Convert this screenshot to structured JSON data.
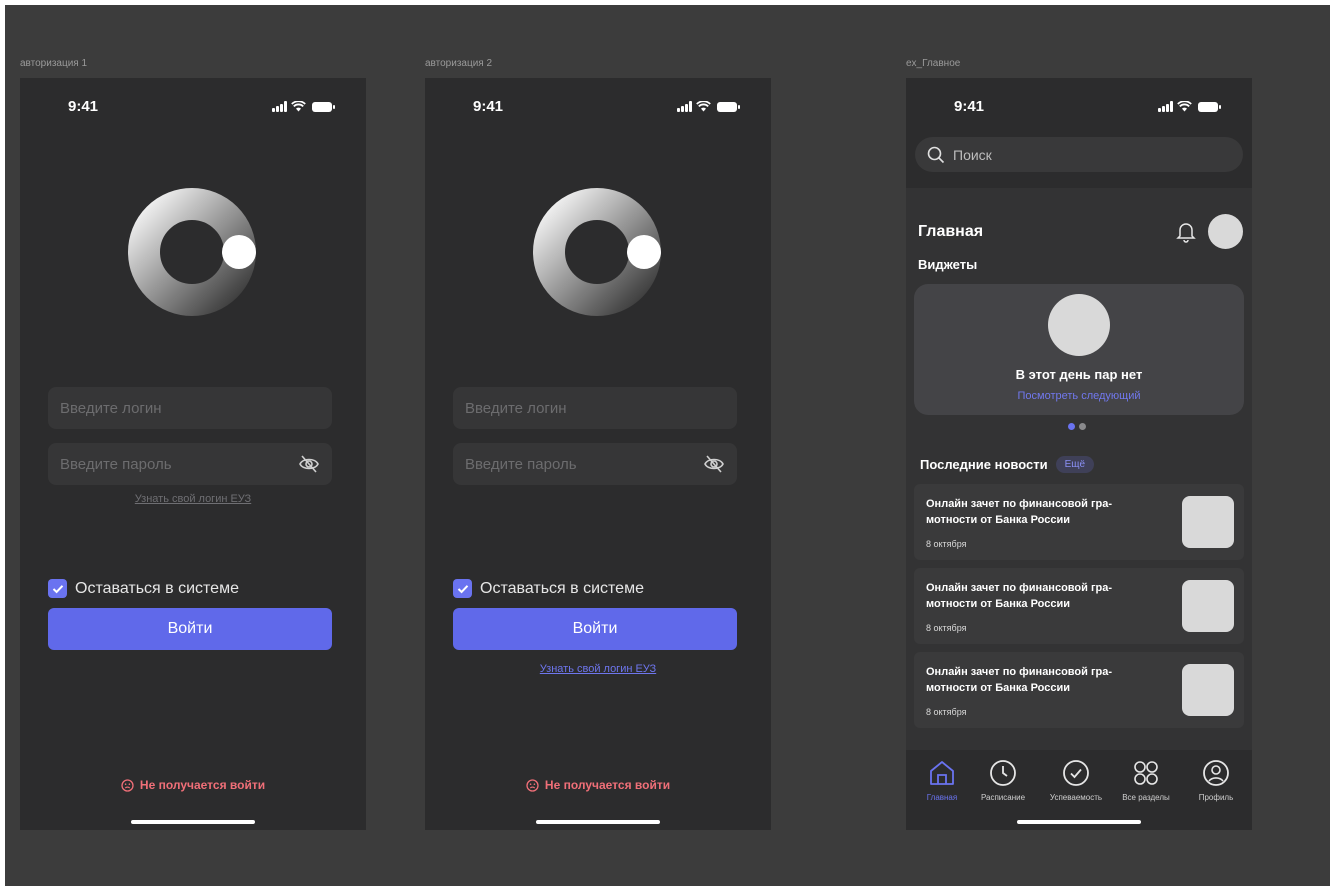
{
  "frames": {
    "login1": {
      "label": "авторизация 1"
    },
    "login2": {
      "label": "авторизация 2"
    },
    "main": {
      "label": "ex_Главное"
    }
  },
  "status": {
    "time": "9:41"
  },
  "login": {
    "login_placeholder": "Введите логин",
    "password_placeholder": "Введите пароль",
    "find_login_link": "Узнать свой логин ЕУЗ",
    "stay_logged_in": "Оставаться в системе",
    "stay_logged_in_checked": true,
    "submit_label": "Войти",
    "trouble_label": "Не получается войти"
  },
  "main": {
    "search_placeholder": "Поиск",
    "page_title": "Главная",
    "widgets_title": "Виджеты",
    "widget": {
      "title": "В этот день пар нет",
      "link": "Посмотреть следующий"
    },
    "news_title": "Последние новости",
    "news_more": "Ещё",
    "news": [
      {
        "title": "Онлайн зачет по финансовой гра-мотности от Банка России",
        "date": "8 октября"
      },
      {
        "title": "Онлайн зачет по финансовой гра-мотности от Банка России",
        "date": "8 октября"
      },
      {
        "title": "Онлайн зачет по финансовой гра-мотности от Банка России",
        "date": "8 октября"
      }
    ],
    "tabs": [
      {
        "label": "Главная",
        "icon": "home-icon",
        "active": true
      },
      {
        "label": "Расписание",
        "icon": "clock-icon",
        "active": false
      },
      {
        "label": "Успеваемость",
        "icon": "check-circle-icon",
        "active": false
      },
      {
        "label": "Все разделы",
        "icon": "grid-icon",
        "active": false
      },
      {
        "label": "Профиль",
        "icon": "user-icon",
        "active": false
      }
    ]
  },
  "colors": {
    "accent": "#6069ea",
    "link_accent": "#7178ee",
    "error": "#f06f78",
    "background": "#3c3c3c",
    "phone_bg": "#2c2c2d"
  }
}
